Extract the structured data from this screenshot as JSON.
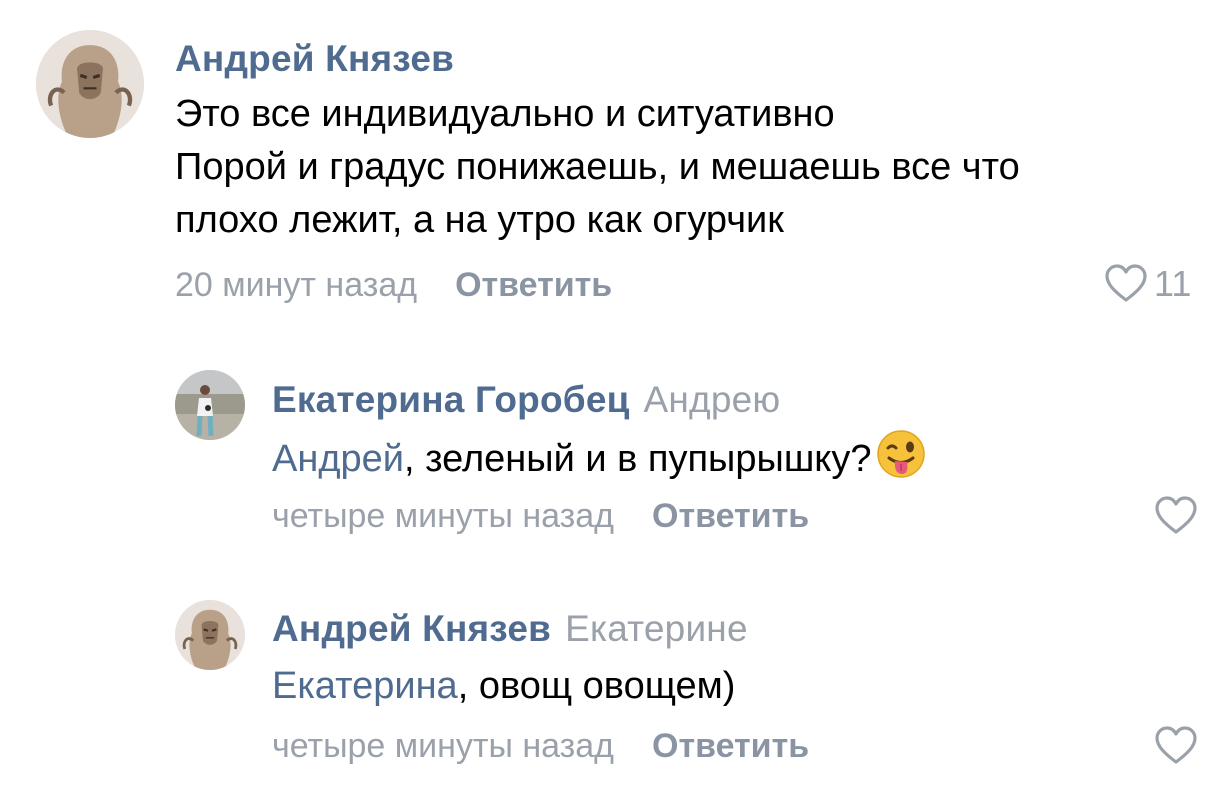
{
  "comments": [
    {
      "author": "Андрей Князев",
      "lines": [
        "Это все индивидуально и ситуативно",
        "Порой и градус понижаешь, и мешаешь все что",
        "плохо лежит, а на утро как огурчик"
      ],
      "time": "20 минут назад",
      "reply_label": "Ответить",
      "likes": "11",
      "avatar_icon": "avatar-icon"
    },
    {
      "author": "Екатерина Горобец",
      "reply_to": "Андрею",
      "mention": "Андрей",
      "text": ", зеленый и в пупырышку?",
      "emoji": "winking-face-with-tongue-icon",
      "time": "четыре минуты назад",
      "reply_label": "Ответить",
      "avatar_icon": "avatar-icon"
    },
    {
      "author": "Андрей Князев",
      "reply_to": "Екатерине",
      "mention": "Екатерина",
      "text": ", овощ овощем)",
      "time": "четыре минуты назад",
      "reply_label": "Ответить",
      "avatar_icon": "avatar-icon"
    }
  ],
  "colors": {
    "name": "#4f6b8f",
    "secondary": "#9aa1aa",
    "reply_button": "#8a94a3",
    "text": "#000000"
  }
}
